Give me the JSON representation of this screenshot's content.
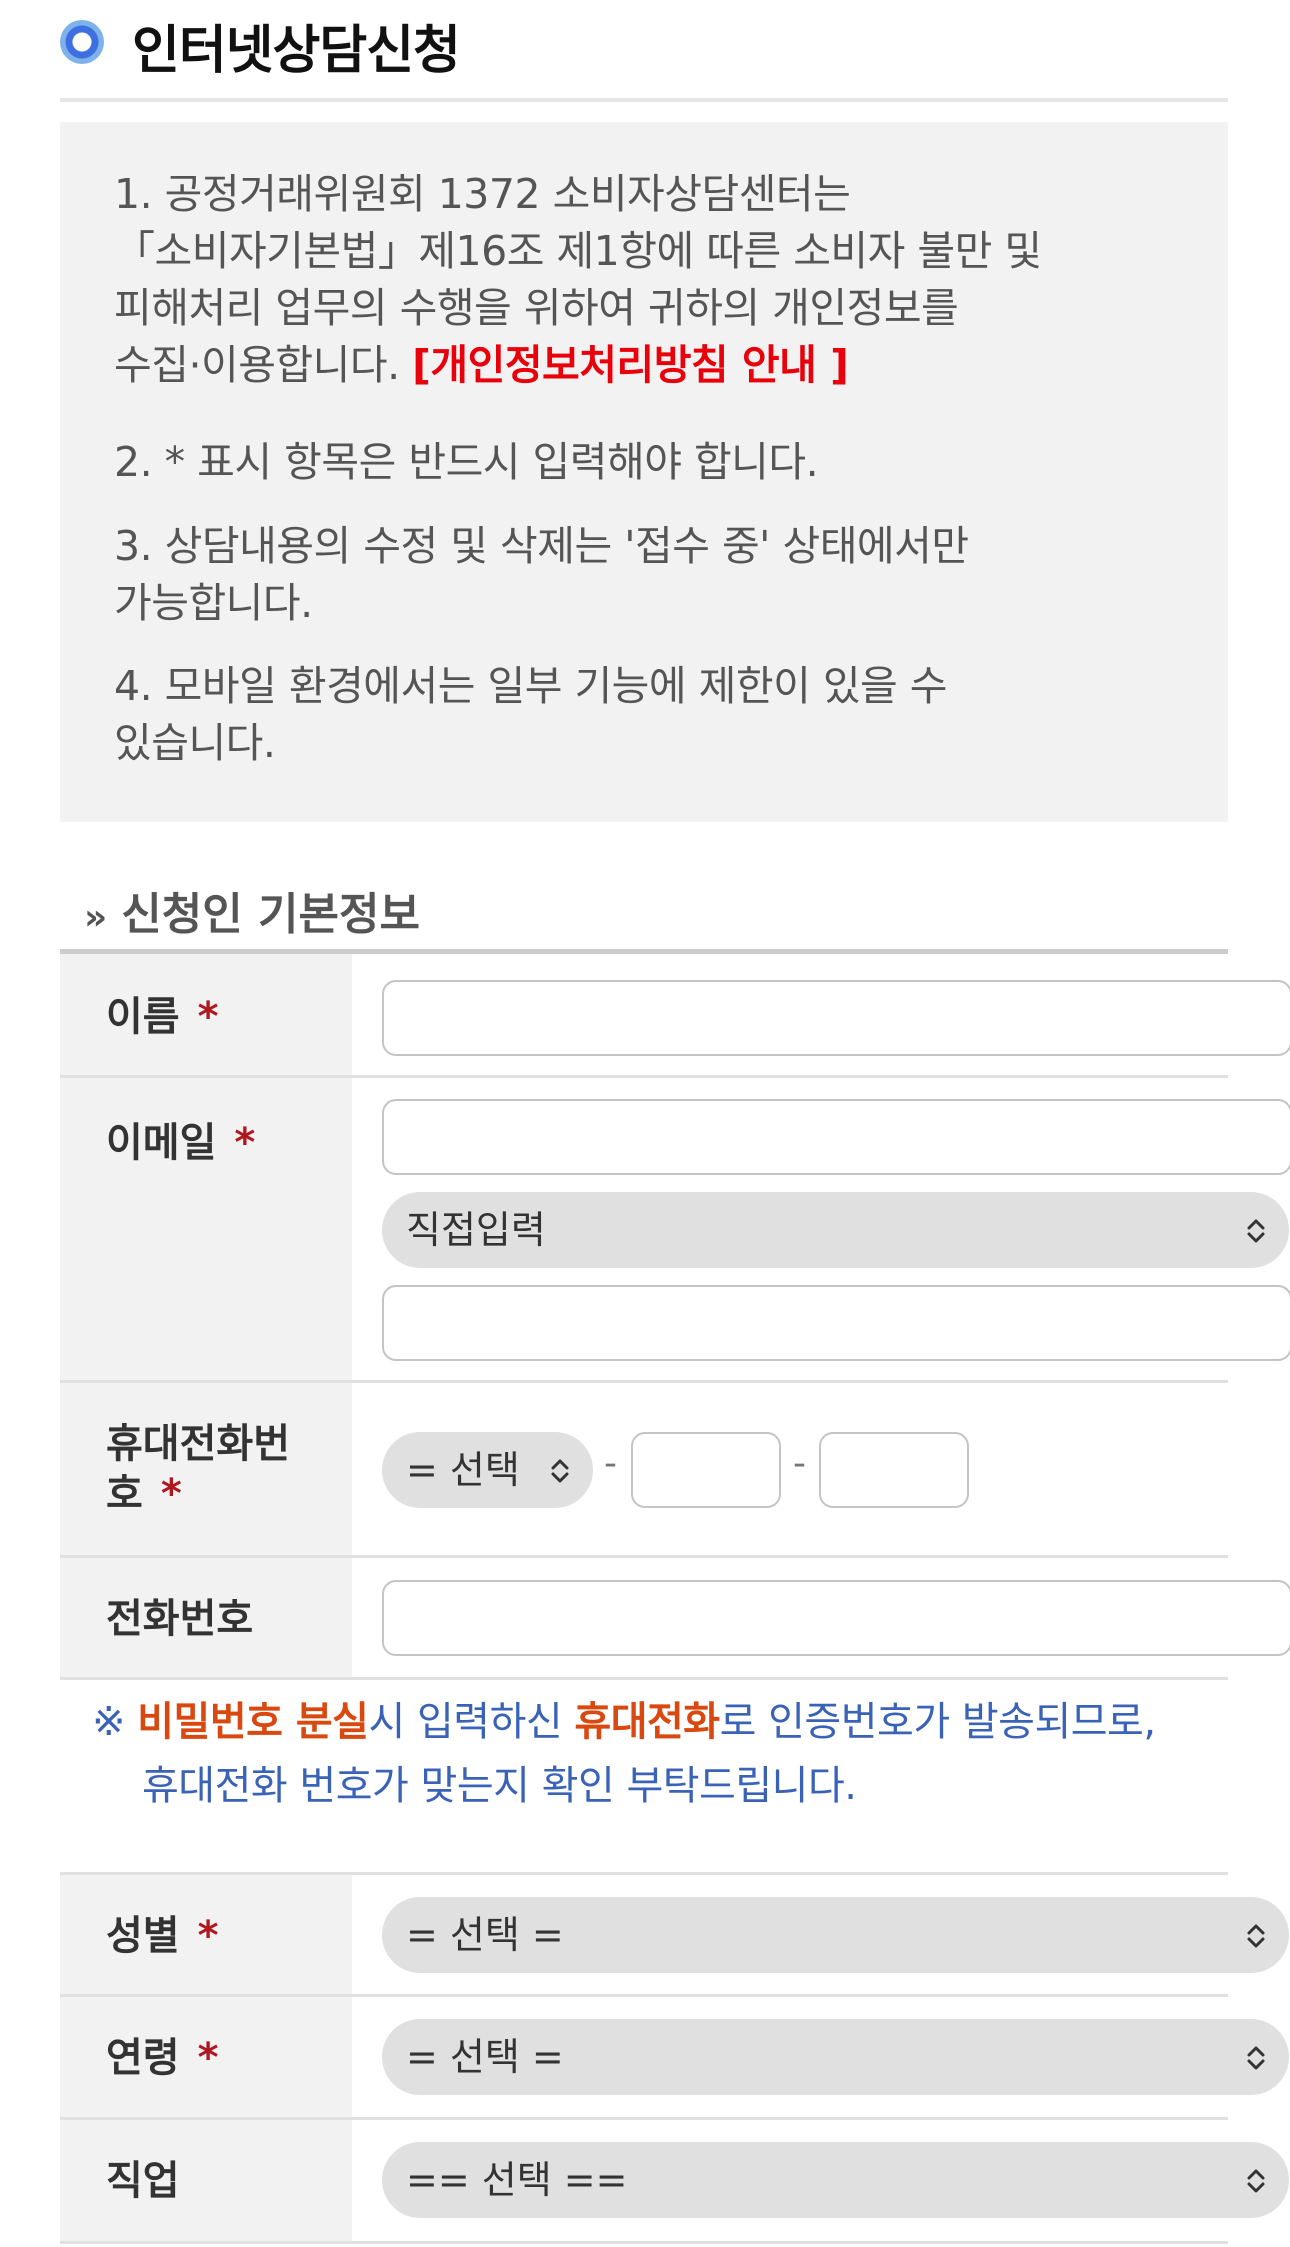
{
  "page": {
    "title": "인터넷상담신청"
  },
  "notice": {
    "item1_line1": "1. 공정거래위원회 1372 소비자상담센터는",
    "item1_line2": "「소비자기본법」제16조 제1항에 따른 소비자 불만 및",
    "item1_line3": "피해처리 업무의 수행을 위하여 귀하의 개인정보를",
    "item1_line4_prefix": "수집·이용합니다. ",
    "privacy_link": "[개인정보처리방침 안내 ]",
    "item2": "2. * 표시 항목은 반드시 입력해야 합니다.",
    "item3_line1": "3. 상담내용의 수정 및 삭제는 '접수 중' 상태에서만",
    "item3_line2": "가능합니다.",
    "item4_line1": "4. 모바일 환경에서는 일부 기능에 제한이 있을 수",
    "item4_line2": "있습니다."
  },
  "section": {
    "title": "신청인 기본정보",
    "marker": "»"
  },
  "form": {
    "required_mark": "*",
    "name_label": "이름",
    "name_value": "",
    "email_label": "이메일",
    "email_id_value": "",
    "email_domain_select": "직접입력",
    "email_domain_value": "",
    "mobile_label_line1": "휴대전화번",
    "mobile_label_line2": "호",
    "mobile_prefix_select": "= 선택",
    "mobile_separator": "-",
    "mobile_middle_value": "",
    "mobile_last_value": "",
    "phone_label": "전화번호",
    "phone_value": "",
    "gender_label": "성별",
    "gender_select": "= 선택 =",
    "age_label": "연령",
    "age_select": "= 선택 =",
    "job_label": "직업",
    "job_select": "== 선택 =="
  },
  "phone_notice": {
    "mark": "※",
    "em1": "비밀번호 분실",
    "text1": "시 입력하신 ",
    "em2": "휴대전화",
    "text2": "로 인증번호가 발송되므로,",
    "line2": "휴대전화 번호가 맞는지 확인 부탁드립니다."
  },
  "colors": {
    "privacy_link": "#e8000b",
    "required_star": "#b0171f",
    "notice_blue": "#3a63b8",
    "notice_emphasis": "#d9480f",
    "label_bg": "#f2f2f2",
    "select_bg": "#e0e0e0"
  },
  "icons": {
    "title_marker": "ring-bullet-icon",
    "select_arrow": "chevron-up-down-icon"
  }
}
